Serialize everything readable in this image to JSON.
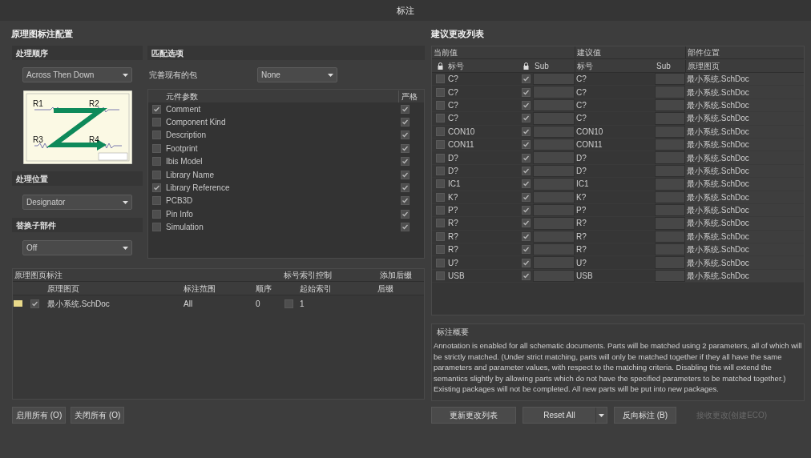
{
  "window": {
    "title": "标注"
  },
  "left": {
    "heading": "原理图标注配置",
    "order": {
      "title": "处理顺序",
      "value": "Across Then Down",
      "diagram_labels": [
        "R1",
        "R2",
        "R3",
        "R4"
      ]
    },
    "location": {
      "title": "处理位置",
      "value": "Designator"
    },
    "replace_subparts": {
      "title": "替换子部件",
      "value": "Off"
    },
    "matching": {
      "title": "匹配选项",
      "complete_label": "完善现有的包",
      "complete_value": "None",
      "columns": [
        "元件参数",
        "严格"
      ],
      "params": [
        {
          "name": "Comment",
          "checked": true,
          "strict": true
        },
        {
          "name": "Component Kind",
          "checked": false,
          "strict": true
        },
        {
          "name": "Description",
          "checked": false,
          "strict": true
        },
        {
          "name": "Footprint",
          "checked": false,
          "strict": true
        },
        {
          "name": "Ibis Model",
          "checked": false,
          "strict": true
        },
        {
          "name": "Library Name",
          "checked": false,
          "strict": true
        },
        {
          "name": "Library Reference",
          "checked": true,
          "strict": true
        },
        {
          "name": "PCB3D",
          "checked": false,
          "strict": true
        },
        {
          "name": "Pin Info",
          "checked": false,
          "strict": true
        },
        {
          "name": "Simulation",
          "checked": false,
          "strict": true
        }
      ]
    },
    "sheets": {
      "group_headers": [
        "原理图页标注",
        "标号索引控制",
        "添加后缀"
      ],
      "columns": [
        "原理图页",
        "标注范围",
        "顺序",
        "起始索引",
        "后缀"
      ],
      "rows": [
        {
          "checked": true,
          "sheet": "最小系统.SchDoc",
          "scope": "All",
          "order": "0",
          "index_enabled": false,
          "start_index": "1"
        }
      ]
    },
    "buttons": [
      "启用所有 (O)",
      "关闭所有 (O)"
    ]
  },
  "right": {
    "heading": "建议更改列表",
    "group_headers": [
      "当前值",
      "建议值",
      "部件位置"
    ],
    "columns": [
      "标号",
      "Sub",
      "标号",
      "Sub",
      "原理图页"
    ],
    "rows": [
      {
        "locked": false,
        "current": "C?",
        "sub_locked": true,
        "proposed": "C?",
        "sheet": "最小系统.SchDoc"
      },
      {
        "locked": false,
        "current": "C?",
        "sub_locked": true,
        "proposed": "C?",
        "sheet": "最小系统.SchDoc"
      },
      {
        "locked": false,
        "current": "C?",
        "sub_locked": true,
        "proposed": "C?",
        "sheet": "最小系统.SchDoc"
      },
      {
        "locked": false,
        "current": "C?",
        "sub_locked": true,
        "proposed": "C?",
        "sheet": "最小系统.SchDoc"
      },
      {
        "locked": false,
        "current": "CON10",
        "sub_locked": true,
        "proposed": "CON10",
        "sheet": "最小系统.SchDoc"
      },
      {
        "locked": false,
        "current": "CON11",
        "sub_locked": true,
        "proposed": "CON11",
        "sheet": "最小系统.SchDoc"
      },
      {
        "locked": false,
        "current": "D?",
        "sub_locked": true,
        "proposed": "D?",
        "sheet": "最小系统.SchDoc"
      },
      {
        "locked": false,
        "current": "D?",
        "sub_locked": true,
        "proposed": "D?",
        "sheet": "最小系统.SchDoc"
      },
      {
        "locked": false,
        "current": "IC1",
        "sub_locked": true,
        "proposed": "IC1",
        "sheet": "最小系统.SchDoc"
      },
      {
        "locked": false,
        "current": "K?",
        "sub_locked": true,
        "proposed": "K?",
        "sheet": "最小系统.SchDoc"
      },
      {
        "locked": false,
        "current": "P?",
        "sub_locked": true,
        "proposed": "P?",
        "sheet": "最小系统.SchDoc"
      },
      {
        "locked": false,
        "current": "R?",
        "sub_locked": true,
        "proposed": "R?",
        "sheet": "最小系统.SchDoc"
      },
      {
        "locked": false,
        "current": "R?",
        "sub_locked": true,
        "proposed": "R?",
        "sheet": "最小系统.SchDoc"
      },
      {
        "locked": false,
        "current": "R?",
        "sub_locked": true,
        "proposed": "R?",
        "sheet": "最小系统.SchDoc"
      },
      {
        "locked": false,
        "current": "U?",
        "sub_locked": true,
        "proposed": "U?",
        "sheet": "最小系统.SchDoc"
      },
      {
        "locked": false,
        "current": "USB",
        "sub_locked": true,
        "proposed": "USB",
        "sheet": "最小系统.SchDoc"
      }
    ],
    "summary": {
      "title": "标注概要",
      "text": "Annotation is enabled for all schematic documents. Parts will be matched using 2 parameters, all of which will be strictly matched. (Under strict matching, parts will only be matched together if they all have the same parameters and parameter values, with respect to the matching criteria. Disabling this will extend the semantics slightly by allowing parts which do not have the specified parameters to be matched together.) Existing packages will not be completed. All new parts will be put into new packages."
    },
    "buttons": [
      {
        "label": "更新更改列表",
        "kind": "button",
        "disabled": false
      },
      {
        "label": "Reset All",
        "kind": "split",
        "disabled": false
      },
      {
        "label": "反向标注 (B)",
        "kind": "button",
        "disabled": false
      },
      {
        "label": "接收更改(创建ECO)",
        "kind": "button",
        "disabled": true
      }
    ]
  }
}
